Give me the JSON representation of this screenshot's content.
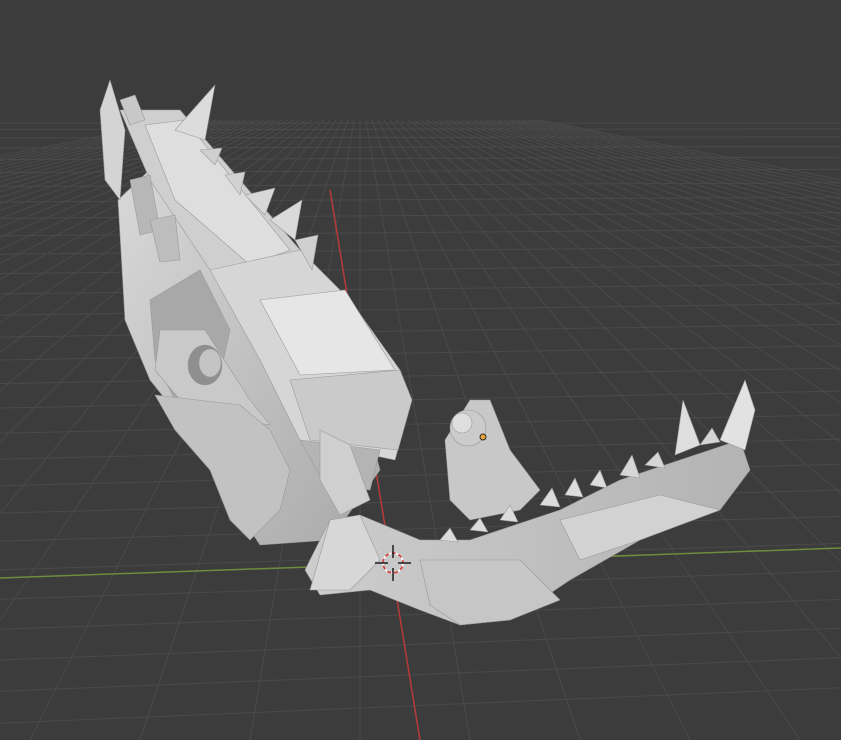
{
  "app": "3D viewport",
  "viewport": {
    "background_color": "#3c3c3c",
    "grid_color": "#4a4a4a",
    "axis_x_color": "#8a5a22",
    "axis_y_color": "#b83a3a",
    "horizon_line_color": "#6e8c3e",
    "model": {
      "name": "skull-model",
      "base_color": "#bfbfbf",
      "light_color": "#e2e2e2",
      "shadow_color": "#8e8e8e"
    },
    "cursor_icon": "3d-cursor-icon",
    "selection_highlight_color": "#e8a33c"
  }
}
